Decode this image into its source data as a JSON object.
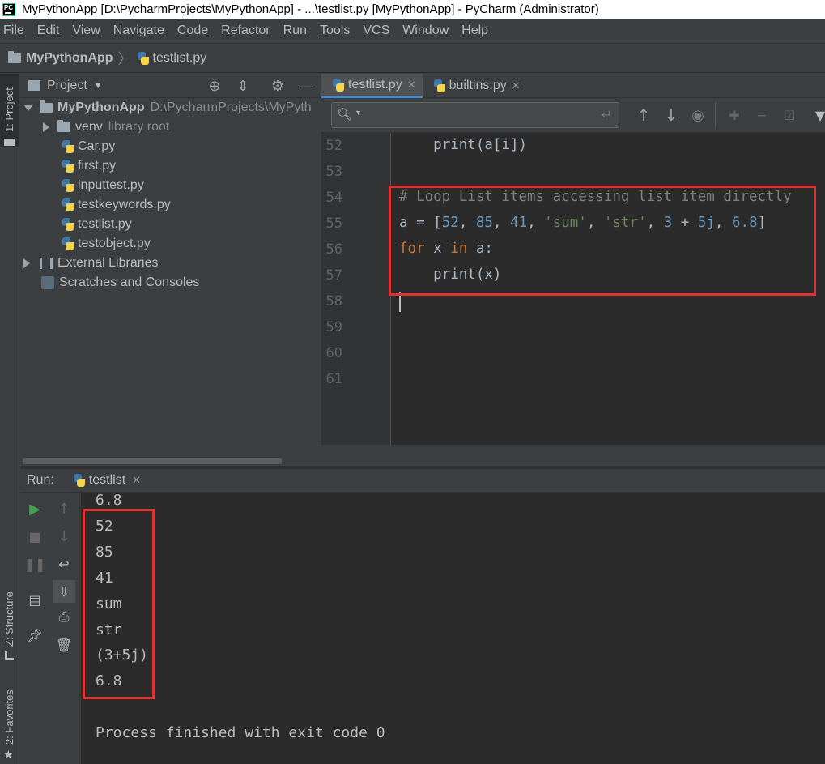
{
  "window": {
    "title": "MyPythonApp [D:\\PycharmProjects\\MyPythonApp] - ...\\testlist.py [MyPythonApp] - PyCharm (Administrator)",
    "logo_text": "PC"
  },
  "menu": [
    "File",
    "Edit",
    "View",
    "Navigate",
    "Code",
    "Refactor",
    "Run",
    "Tools",
    "VCS",
    "Window",
    "Help"
  ],
  "breadcrumb": {
    "project": "MyPythonApp",
    "file": "testlist.py"
  },
  "left_stripe": {
    "project_tab": "1: Project",
    "structure_tab": "Z: Structure",
    "favorites_tab": "2: Favorites"
  },
  "project_panel": {
    "title": "Project",
    "root": {
      "name": "MyPythonApp",
      "path": "D:\\PycharmProjects\\MyPyth"
    },
    "venv": {
      "name": "venv",
      "note": "library root"
    },
    "files": [
      "Car.py",
      "first.py",
      "inputtest.py",
      "testkeywords.py",
      "testlist.py",
      "testobject.py"
    ],
    "external_libraries": "External Libraries",
    "scratches": "Scratches and Consoles"
  },
  "editor_tabs": [
    {
      "label": "testlist.py",
      "active": true
    },
    {
      "label": "builtins.py",
      "active": false
    }
  ],
  "editor": {
    "line_numbers": [
      "52",
      "53",
      "54",
      "55",
      "56",
      "57",
      "58",
      "59",
      "60",
      "61"
    ],
    "line52": {
      "indent": "    ",
      "code": "print(a[i])"
    },
    "line54": "# Loop List items accessing list item directly",
    "line55": {
      "a": "a = [",
      "n1": "52",
      "c1": ", ",
      "n2": "85",
      "c2": ", ",
      "n3": "41",
      "c3": ", ",
      "s1": "'sum'",
      "c4": ", ",
      "s2": "'str'",
      "c5": ", ",
      "n4": "3",
      "op": " + ",
      "n5": "5j",
      "c6": ", ",
      "n6": "6.8",
      "end": "]"
    },
    "line56": {
      "kw1": "for",
      "mid": " x ",
      "kw2": "in",
      "end": " a:"
    },
    "line57": "    print(x)"
  },
  "run_panel": {
    "label": "Run:",
    "tab": "testlist",
    "output": [
      "6.8",
      "52",
      "85",
      "41",
      "sum",
      "str",
      "(3+5j)",
      "6.8"
    ],
    "finished": "Process finished with exit code 0"
  },
  "colors": {
    "highlight_box": "#e03131",
    "keyword": "#cc7832",
    "number": "#6897bb",
    "string": "#6a8759",
    "comment": "#808080",
    "run_green": "#499c54"
  }
}
